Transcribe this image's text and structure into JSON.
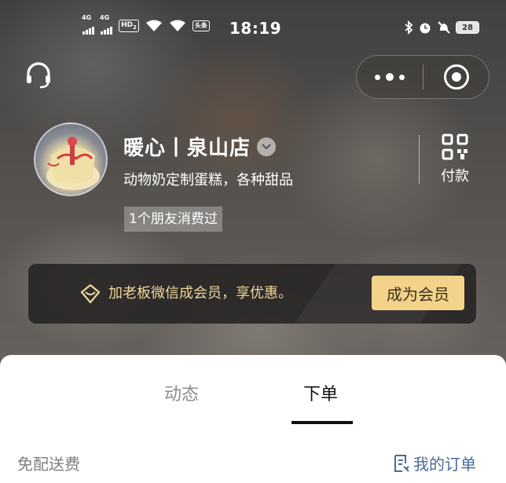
{
  "status_bar": {
    "net1": "4G",
    "net2": "4G",
    "hd": "HD",
    "hd_sub": "2",
    "tt": "头条",
    "time": "18:19",
    "battery": "28"
  },
  "shop": {
    "name": "暖心丨泉山店",
    "description": "动物奶定制蛋糕，各种甜品",
    "friends_badge": "1个朋友消费过",
    "pay_label": "付款"
  },
  "member": {
    "text": "加老板微信成会员，享优惠。",
    "button": "成为会员"
  },
  "tabs": [
    {
      "label": "动态",
      "active": false
    },
    {
      "label": "下单",
      "active": true
    }
  ],
  "order_bar": {
    "free_delivery": "免配送费",
    "my_orders": "我的订单"
  },
  "colors": {
    "member_text": "#f0d69a",
    "member_button": "#f3d38a",
    "link_blue": "#4a6a9a"
  },
  "icons": {
    "customer_service": "headset-icon",
    "more": "more-dots-icon",
    "close": "target-close-icon",
    "verify": "chevron-down-icon",
    "pay": "qr-code-icon",
    "member": "diamond-icon",
    "orders": "order-list-icon"
  }
}
